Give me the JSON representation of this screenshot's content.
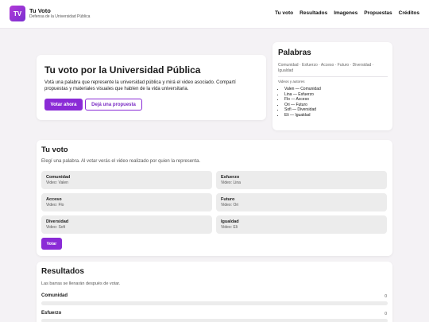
{
  "header": {
    "logo_text": "TV",
    "title": "Tu Voto",
    "subtitle": "Defensa de la Universidad Pública",
    "nav": [
      "Tu voto",
      "Resultados",
      "Imagenes",
      "Propuestas",
      "Créditos"
    ]
  },
  "hero": {
    "title": "Tu voto por la Universidad Pública",
    "text": "Votá una palabra que represente la universidad pública y mirá el video asociado. Compartí propuestas y materiales visuales que hablen de la vida universitaria.",
    "vote_button": "Votar ahora",
    "proposal_button": "Dejá una propuesta"
  },
  "words_panel": {
    "title": "Palabras",
    "tags": "Comunidad · Esfuerzo · Acceso · Futuro · Diversidad · Igualdad",
    "subheading": "Videos y autores",
    "authors": [
      "Valen — Comunidad",
      "Lina — Esfuerzo",
      "Flo — Acceso",
      "Ori — Futuro",
      "Sofi — Diversidad",
      "Eli — Igualdad"
    ]
  },
  "vote": {
    "title": "Tu voto",
    "intro": "Elegí una palabra. Al votar verás el video realizado por quien la representa.",
    "options": [
      {
        "word": "Comunidad",
        "video": "Video: Valen"
      },
      {
        "word": "Esfuerzo",
        "video": "Video: Lina"
      },
      {
        "word": "Acceso",
        "video": "Video: Flo"
      },
      {
        "word": "Futuro",
        "video": "Video: Ori"
      },
      {
        "word": "Diversidad",
        "video": "Video: Sofi"
      },
      {
        "word": "Igualdad",
        "video": "Video: Eli"
      }
    ],
    "submit": "Votar"
  },
  "results": {
    "title": "Resultados",
    "note": "Las barras se llenarán después de votar.",
    "rows": [
      {
        "label": "Comunidad",
        "count": "0",
        "fill": 0
      },
      {
        "label": "Esfuerzo",
        "count": "0",
        "fill": 0
      }
    ]
  },
  "colors": {
    "accent": "#8a2bd6",
    "background": "#f4f2f5",
    "option_bg": "#ececec"
  }
}
